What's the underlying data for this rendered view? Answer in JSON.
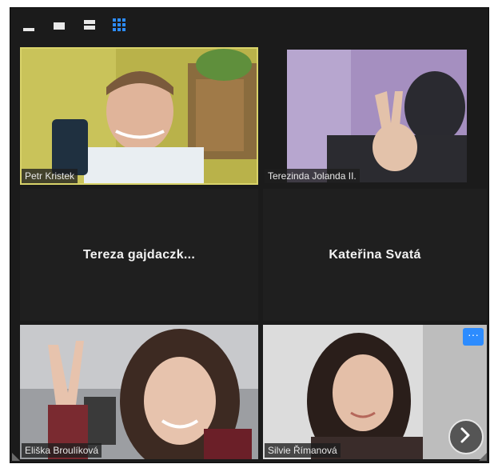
{
  "toolbar": {
    "icons": [
      "minimize-view-icon",
      "speaker-view-icon",
      "strip-view-icon",
      "gallery-view-icon"
    ],
    "active_color": "#2d8cff"
  },
  "participants": [
    {
      "name": "Petr Kristek",
      "video": true,
      "active_speaker": true
    },
    {
      "name": "Terezinda Jolanda II.",
      "video": true,
      "active_speaker": false
    },
    {
      "name": "Tereza  gajdaczk...",
      "video": false
    },
    {
      "name": "Kateřina Svatá",
      "video": false
    },
    {
      "name": "Eliška Broulíková",
      "video": true,
      "active_speaker": false
    },
    {
      "name": "Silvie Římanová",
      "video": true,
      "active_speaker": false
    }
  ],
  "controls": {
    "more_label": "···",
    "next_page_icon": "chevron-right-icon"
  },
  "colors": {
    "background": "#1b1b1b",
    "active_speaker_border": "#d9d36a",
    "accent": "#2d8cff"
  }
}
